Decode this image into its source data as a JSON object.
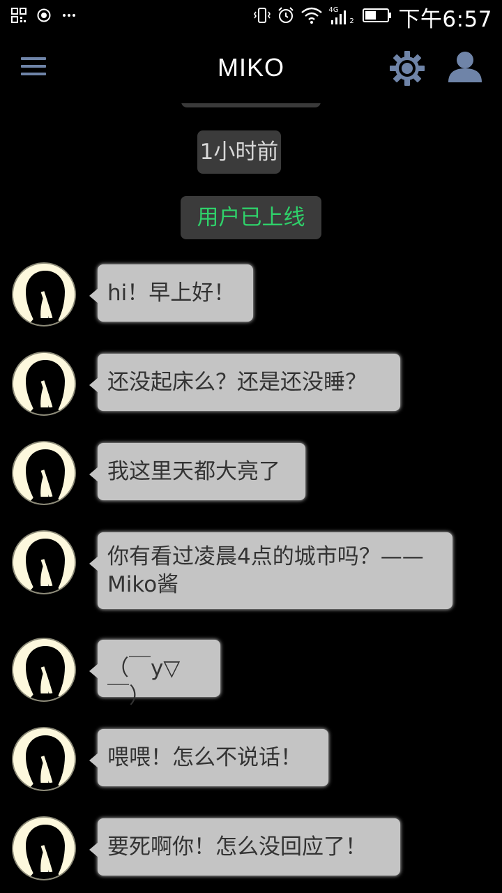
{
  "status_bar": {
    "time": "下午6:57",
    "network_label": "4G",
    "sim_label": "2",
    "left_icons": [
      "qr-scan-icon",
      "record-icon",
      "more-dots-icon"
    ],
    "right_icons": [
      "vibrate-icon",
      "alarm-icon",
      "wifi-icon",
      "signal-icon",
      "battery-icon"
    ]
  },
  "header": {
    "title": "MIKO",
    "menu_icon": "hamburger-menu-icon",
    "settings_icon": "gear-icon",
    "profile_icon": "user-icon"
  },
  "chat": {
    "time_label": "1小时前",
    "system_status": "用户已上线",
    "messages": [
      {
        "sender": "Miko",
        "text": "hi！早上好！"
      },
      {
        "sender": "Miko",
        "text": "还没起床么？还是还没睡？"
      },
      {
        "sender": "Miko",
        "text": "我这里天都大亮了"
      },
      {
        "sender": "Miko",
        "text": "你有看过凌晨4点的城市吗？——Miko酱"
      },
      {
        "sender": "Miko",
        "text": "（￣y▽￣）"
      },
      {
        "sender": "Miko",
        "text": "喂喂！怎么不说话！"
      },
      {
        "sender": "Miko",
        "text": "要死啊你！怎么没回应了！"
      }
    ]
  },
  "colors": {
    "background": "#000000",
    "bubble": "#c4c4c4",
    "bubble_text": "#333333",
    "online_green": "#2fd16a",
    "header_icon_blue": "#6f84a8",
    "pill_bg": "#3b3b3b"
  }
}
